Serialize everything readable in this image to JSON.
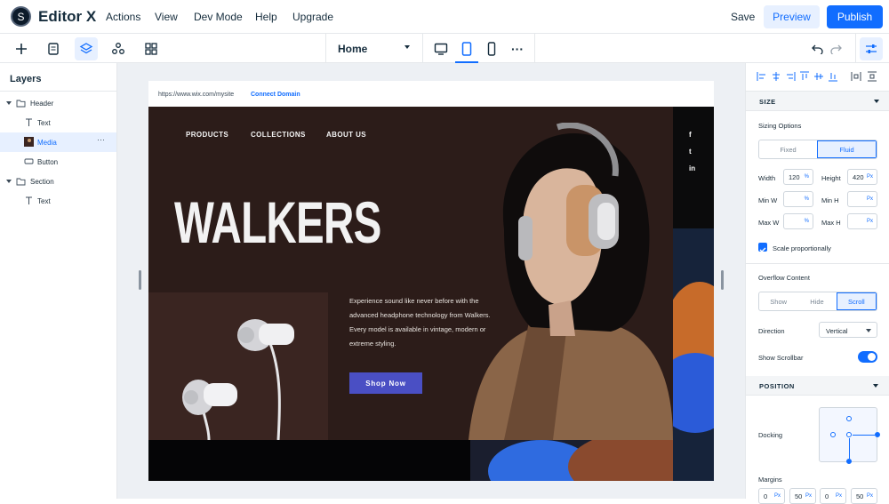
{
  "app": {
    "logo_letter": "S",
    "brand": "Editor X"
  },
  "topbar": {
    "menus": [
      "Actions",
      "View",
      "Dev Mode",
      "Help",
      "Upgrade"
    ],
    "save": "Save",
    "preview": "Preview",
    "publish": "Publish"
  },
  "toolbar": {
    "page": "Home",
    "more": "···"
  },
  "layers": {
    "title": "Layers",
    "items": [
      {
        "label": "Header",
        "icon": "folder-icon"
      },
      {
        "label": "Text",
        "icon": "text-icon"
      },
      {
        "label": "Media",
        "icon": "image-icon"
      },
      {
        "label": "Button",
        "icon": "button-icon"
      },
      {
        "label": "Section",
        "icon": "folder-icon"
      },
      {
        "label": "Text",
        "icon": "text-icon"
      }
    ],
    "more": "···"
  },
  "site": {
    "url": "https://www.wix.com/mysite",
    "connect": "Connect Domain",
    "nav": [
      "PRODUCTS",
      "COLLECTIONS",
      "ABOUT US"
    ],
    "headline": "WALKERS",
    "description": "Experience sound like never before with the advanced headphone technology from Walkers. Every model is available in vintage, modern or extreme styling.",
    "cta": "Shop Now",
    "social": [
      "f",
      "t",
      "in"
    ]
  },
  "props": {
    "size": {
      "title": "SIZE",
      "sizing_label": "Sizing Options",
      "sizing": [
        "Fixed",
        "Fluid"
      ],
      "width_label": "Width",
      "width": "120",
      "width_unit": "%",
      "height_label": "Height",
      "height": "420",
      "height_unit": "Px",
      "minw_label": "Min W",
      "minw_unit": "%",
      "minh_label": "Min H",
      "minh_unit": "Px",
      "maxw_label": "Max W",
      "maxw_unit": "%",
      "maxh_label": "Max H",
      "maxh_unit": "Px",
      "scale_label": "Scale proportionally",
      "overflow_label": "Overflow Content",
      "overflow": [
        "Show",
        "Hide",
        "Scroll"
      ],
      "direction_label": "Direction",
      "direction": "Vertical",
      "scrollbar_label": "Show Scrollbar"
    },
    "position": {
      "title": "POSITION",
      "docking_label": "Docking",
      "margins_label": "Margins",
      "margins": [
        "0",
        "50",
        "0",
        "50"
      ],
      "margin_unit": "Px"
    }
  },
  "colors": {
    "accent": "#116dff",
    "cta": "#4a4fc4",
    "hero_bg": "#2c1c19"
  }
}
